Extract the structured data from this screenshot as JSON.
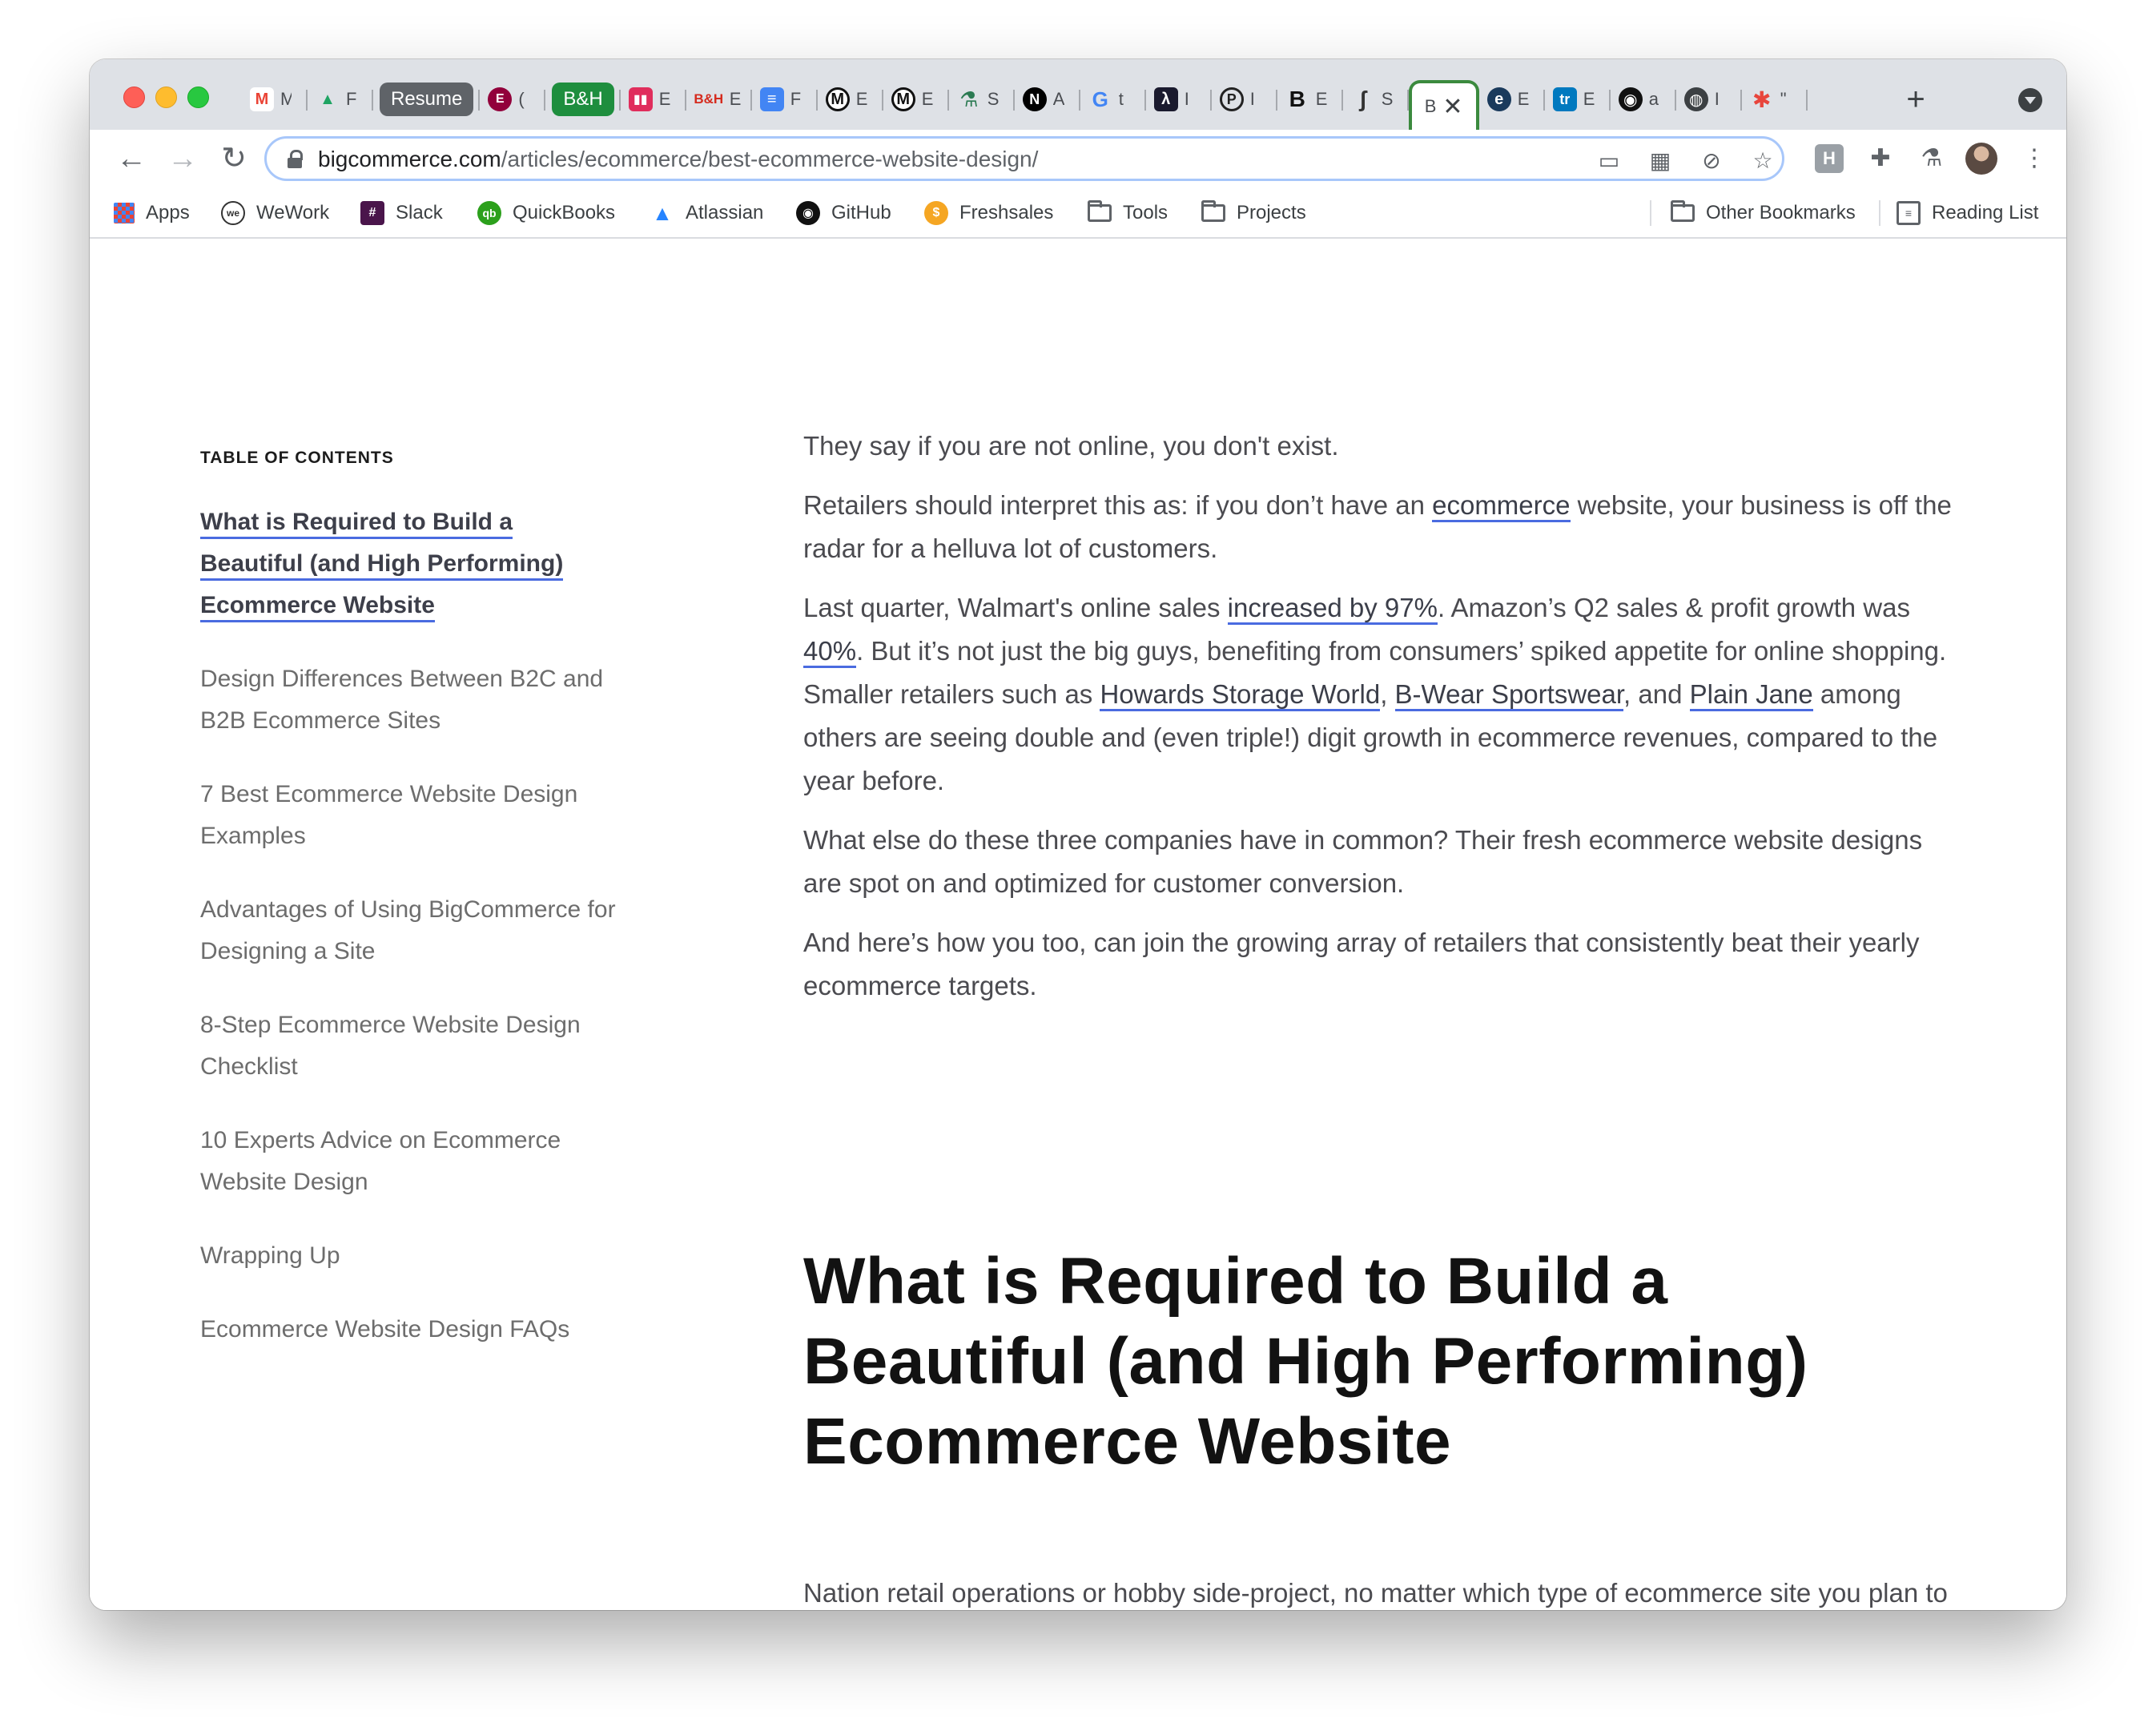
{
  "tabs": [
    {
      "title": "M",
      "icon": "gmail-icon",
      "color": "#ea4335",
      "glyph": "M"
    },
    {
      "title": "F",
      "icon": "google-drive-icon",
      "color": "#1fa463",
      "glyph": "▲"
    },
    {
      "group": "Resume",
      "group_color": "#5f6368"
    },
    {
      "title": "(",
      "icon": "elementor-icon",
      "color": "#92003b",
      "glyph": "E"
    },
    {
      "group": "B&H",
      "group_color": "#1e8e3e"
    },
    {
      "title": "E",
      "icon": "bh-icon",
      "color": "#e02d5c",
      "glyph": "B"
    },
    {
      "title": "E",
      "icon": "bh-logo-icon",
      "color": "#d52b1e",
      "glyph": "B"
    },
    {
      "title": "F",
      "icon": "google-docs-icon",
      "color": "#4285f4",
      "glyph": "≡"
    },
    {
      "title": "E",
      "icon": "medium-icon",
      "color": "#111111",
      "glyph": "M"
    },
    {
      "title": "E",
      "icon": "medium-icon",
      "color": "#111111",
      "glyph": "M"
    },
    {
      "title": "S",
      "icon": "flask-icon",
      "color": "#2b7a52",
      "glyph": "⚗"
    },
    {
      "title": "A",
      "icon": "notion-icon",
      "color": "#000000",
      "glyph": "N"
    },
    {
      "title": "t",
      "icon": "google-icon",
      "color": "#4285f4",
      "glyph": "G"
    },
    {
      "title": "I",
      "icon": "lambda-icon",
      "color": "#1a1a2e",
      "glyph": "λ"
    },
    {
      "title": "I",
      "icon": "p-icon",
      "color": "#222222",
      "glyph": "P"
    },
    {
      "title": "E",
      "icon": "bold-b-icon",
      "color": "#111111",
      "glyph": "B"
    },
    {
      "title": "S",
      "icon": "script-icon",
      "color": "#333333",
      "glyph": "ʃ"
    },
    {
      "title": "B",
      "icon": "bigcommerce-icon",
      "active": true
    },
    {
      "title": "E",
      "icon": "edge-icon",
      "color": "#1a3a5c",
      "glyph": "e"
    },
    {
      "title": "E",
      "icon": "trello-icon",
      "color": "#0079bf",
      "glyph": "tr"
    },
    {
      "title": "a",
      "icon": "github-icon",
      "color": "#111111",
      "glyph": "◉"
    },
    {
      "title": "I",
      "icon": "globe-icon",
      "color": "#3c4043",
      "glyph": "◍"
    },
    {
      "title": "\"",
      "icon": "asterisk-icon",
      "color": "#e8453c",
      "glyph": "✱"
    }
  ],
  "toolbar": {
    "url_host": "bigcommerce.com",
    "url_path": "/articles/ecommerce/best-ecommerce-website-design/"
  },
  "bookmarks": [
    {
      "label": "Apps",
      "icon": "apps-grid-icon"
    },
    {
      "label": "WeWork",
      "icon": "wework-icon"
    },
    {
      "label": "Slack",
      "icon": "slack-icon"
    },
    {
      "label": "QuickBooks",
      "icon": "quickbooks-icon"
    },
    {
      "label": "Atlassian",
      "icon": "atlassian-icon"
    },
    {
      "label": "GitHub",
      "icon": "github-icon"
    },
    {
      "label": "Freshsales",
      "icon": "freshsales-icon"
    },
    {
      "label": "Tools",
      "icon": "folder-icon"
    },
    {
      "label": "Projects",
      "icon": "folder-icon"
    }
  ],
  "bookmarks_right": [
    {
      "label": "Other Bookmarks",
      "icon": "folder-icon"
    },
    {
      "label": "Reading List",
      "icon": "reading-list-icon"
    }
  ],
  "toc": {
    "title": "TABLE OF CONTENTS",
    "items": [
      "What is Required to Build a Beautiful (and High Performing) Ecommerce Website",
      "Design Differences Between B2C and B2B Ecommerce Sites",
      "7 Best Ecommerce Website Design Examples",
      "Advantages of Using BigCommerce for Designing a Site",
      "8-Step Ecommerce Website Design Checklist",
      "10 Experts Advice on Ecommerce Website Design",
      "Wrapping Up",
      "Ecommerce Website Design FAQs"
    ]
  },
  "article": {
    "p1": "They say if you are not online, you don't exist.",
    "p2": {
      "a": "Retailers should interpret this as: if you don’t have an ",
      "link": "ecommerce",
      "b": " website, your business is off the radar for a helluva lot of customers."
    },
    "p3": {
      "a": "Last quarter, Walmart's online sales ",
      "l1": "increased by 97%",
      "b": ". Amazon’s Q2 sales & profit growth was ",
      "l2": "40%",
      "c": ". But it’s not just the big guys, benefiting from consumers’ spiked appetite for online shopping. Smaller retailers such as ",
      "l3": "Howards Storage World",
      "d": ", ",
      "l4": "B-Wear Sportswear",
      "e": ", and ",
      "l5": "Plain Jane",
      "f": " among others are seeing double and (even triple!) digit growth in ecommerce revenues, compared to the year before."
    },
    "p4": "What else do these three companies have in common? Their fresh ecommerce website designs are spot on and optimized for customer conversion.",
    "p5": "And here’s how you too, can join the growing array of retailers that consistently beat their yearly ecommerce targets.",
    "heading": "What is Required to Build a Beautiful (and High Performing) Ecommerce Website",
    "p6": "Nation retail operations or hobby side-project, no matter which type of ecommerce site you plan to build the first thing you need is an ecommerce platform to help you build it."
  }
}
